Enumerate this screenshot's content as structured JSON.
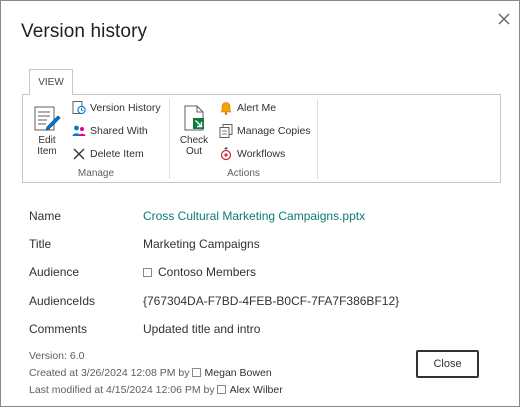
{
  "dialog": {
    "title": "Version history"
  },
  "ribbon": {
    "tab_label": "VIEW",
    "manage": {
      "group_label": "Manage",
      "edit_item_line1": "Edit",
      "edit_item_line2": "Item",
      "version_history": "Version History",
      "shared_with": "Shared With",
      "delete_item": "Delete Item"
    },
    "actions": {
      "group_label": "Actions",
      "check_out_line1": "Check",
      "check_out_line2": "Out",
      "alert_me": "Alert Me",
      "manage_copies": "Manage Copies",
      "workflows": "Workflows"
    }
  },
  "properties": {
    "name": {
      "label": "Name",
      "value": "Cross Cultural Marketing Campaigns.pptx"
    },
    "title": {
      "label": "Title",
      "value": "Marketing Campaigns"
    },
    "audience": {
      "label": "Audience",
      "value": "Contoso Members"
    },
    "audience_ids": {
      "label": "AudienceIds",
      "value": "{767304DA-F7BD-4FEB-B0CF-7FA7F386BF12}"
    },
    "comments": {
      "label": "Comments",
      "value": "Updated title and intro"
    }
  },
  "footer": {
    "version": "Version: 6.0",
    "created_prefix": "Created at 3/26/2024 12:08 PM  by",
    "created_by": "Megan Bowen",
    "modified_prefix": "Last modified at 4/15/2024 12:06 PM  by",
    "modified_by": "Alex Wilber",
    "close_label": "Close"
  },
  "colors": {
    "link": "#0b7a75",
    "border": "#8a8886"
  },
  "icons": [
    "close-icon",
    "edit-item-icon",
    "version-history-icon",
    "shared-with-icon",
    "delete-icon",
    "check-out-icon",
    "alert-bell-icon",
    "manage-copies-icon",
    "workflows-icon"
  ]
}
